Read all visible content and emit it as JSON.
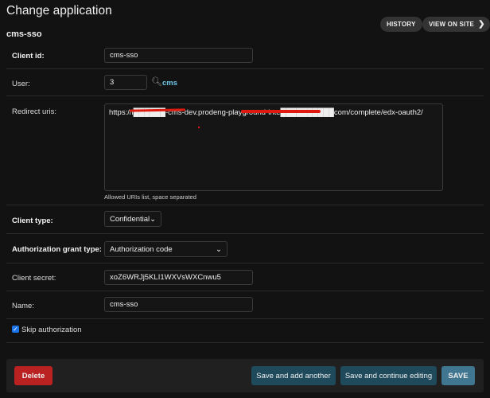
{
  "header": {
    "title": "Change application",
    "object_name": "cms-sso",
    "history_label": "HISTORY",
    "view_on_site_label": "VIEW ON SITE"
  },
  "form": {
    "client_id": {
      "label": "Client id:",
      "value": "cms-sso"
    },
    "user": {
      "label": "User:",
      "value": "3",
      "lookup_text": "cms"
    },
    "redirect_uris": {
      "label": "Redirect uris:",
      "value": "https://l██████-cms-dev.prodeng-playground-inte██████████com/complete/edx-oauth2/",
      "help": "Allowed URIs list, space separated"
    },
    "client_type": {
      "label": "Client type:",
      "value": "Confidential"
    },
    "grant_type": {
      "label": "Authorization grant type:",
      "value": "Authorization code"
    },
    "client_secret": {
      "label": "Client secret:",
      "value": "xoZ6WRJj5KLI1WXVsWXCnwu5"
    },
    "name": {
      "label": "Name:",
      "value": "cms-sso"
    },
    "skip_authorization": {
      "label": "Skip authorization",
      "checked": true
    }
  },
  "footer": {
    "delete": "Delete",
    "save_add": "Save and add another",
    "save_continue": "Save and continue editing",
    "save": "SAVE"
  },
  "colors": {
    "delete": "#ba2121",
    "save_secondary": "#1f4a5c",
    "save_primary": "#417690",
    "link": "#6fc7e8",
    "redaction": "#e0190f"
  }
}
